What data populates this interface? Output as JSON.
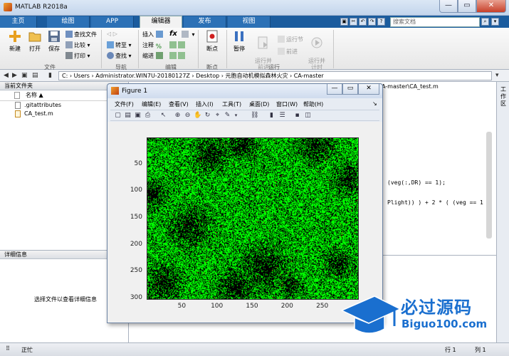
{
  "window": {
    "title": "MATLAB R2018a"
  },
  "tabs": [
    {
      "label": "主页"
    },
    {
      "label": "绘图"
    },
    {
      "label": "APP"
    },
    {
      "label": "编辑器"
    },
    {
      "label": "发布"
    },
    {
      "label": "视图"
    }
  ],
  "search": {
    "placeholder": "搜索文档"
  },
  "ribbon": {
    "file": {
      "new": "新建",
      "open": "打开",
      "save": "保存",
      "find_files": "查找文件",
      "compare": "比较",
      "print": "打印",
      "group": "文件"
    },
    "navigate": {
      "goto": "转至",
      "find": "查找",
      "group": "导航"
    },
    "edit": {
      "insert": "插入",
      "comment": "注释",
      "indent": "缩进",
      "fx": "fx",
      "group": "编辑"
    },
    "breakpoints": {
      "label": "断点",
      "group": "断点"
    },
    "run": {
      "pause": "暂停",
      "run_advance": "运行并\n前进",
      "run_section": "运行节",
      "advance": "前进",
      "run_time": "运行并\n计时",
      "group": "运行"
    }
  },
  "address": {
    "segments": "C: › Users › Administrator.WIN7U-20180127Z › Desktop › 元胞自动机模拟森林火灾 › CA-master"
  },
  "file_pane": {
    "title": "当前文件夹",
    "column": "名称 ▲",
    "files": [
      {
        "name": ".gitattributes"
      },
      {
        "name": "CA_test.m"
      }
    ]
  },
  "details_pane": {
    "title": "详细信息",
    "message": "选择文件以查看详细信息"
  },
  "editor": {
    "path": "A-master\\CA_test.m",
    "code1": "(veg(:,DR) == 1);",
    "code2": "Plight)) ) + 2 * ( (veg == 1"
  },
  "right_strip": {
    "label": "工作区"
  },
  "status": {
    "state": "正忙",
    "row_label": "行",
    "row": "1",
    "col_label": "列",
    "col": "1"
  },
  "figure": {
    "title": "Figure 1",
    "menu": [
      "文件(F)",
      "编辑(E)",
      "查看(V)",
      "插入(I)",
      "工具(T)",
      "桌面(D)",
      "窗口(W)",
      "帮助(H)"
    ]
  },
  "chart_data": {
    "type": "heatmap",
    "title": "",
    "xlabel": "",
    "ylabel": "",
    "x_ticks": [
      50,
      100,
      150,
      200,
      250
    ],
    "y_ticks": [
      50,
      100,
      150,
      200,
      250,
      300
    ],
    "xlim": [
      0,
      300
    ],
    "ylim": [
      0,
      300
    ],
    "y_reversed": true,
    "colors": {
      "vegetation": "#00ff00",
      "empty": "#000000",
      "fire": "#ff0000"
    }
  },
  "watermark": {
    "cn": "必过源码",
    "en": "Biguo100.com"
  },
  "colors": {
    "tab_bar": "#1b5c9e",
    "accent": "#1a6fcf"
  }
}
